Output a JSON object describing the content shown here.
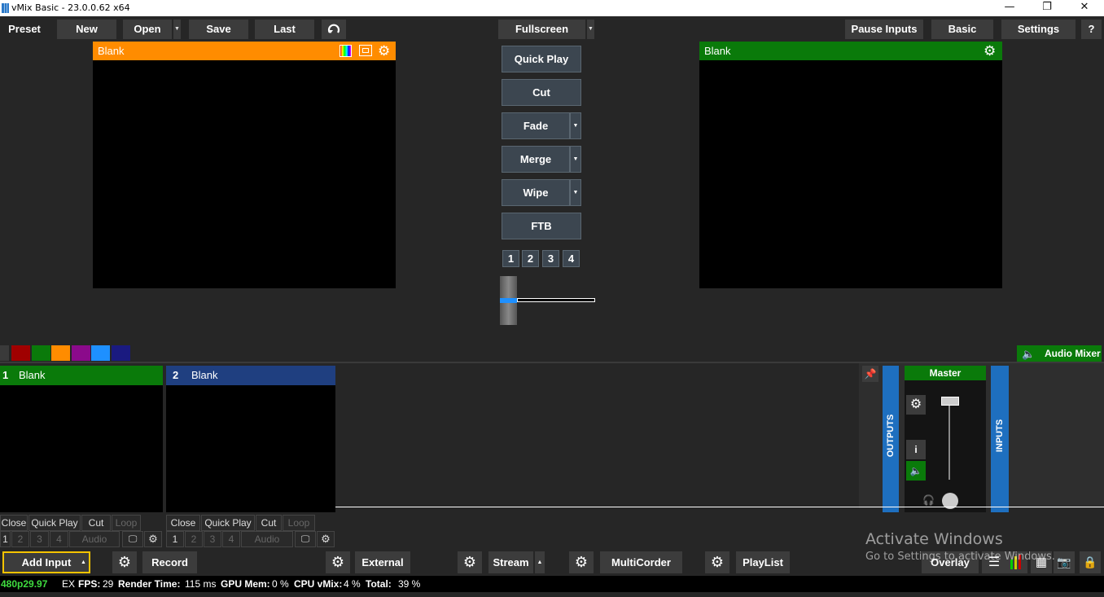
{
  "window": {
    "title": "vMix Basic - 23.0.0.62 x64",
    "minimize": "—",
    "restore": "❐",
    "close": "✕"
  },
  "toolbar": {
    "preset": "Preset",
    "new": "New",
    "open": "Open",
    "save": "Save",
    "last": "Last",
    "fullscreen": "Fullscreen",
    "pause_inputs": "Pause Inputs",
    "basic": "Basic",
    "settings": "Settings",
    "help": "?"
  },
  "preview": {
    "title": "Blank",
    "header_color": "#ff8c00"
  },
  "output": {
    "title": "Blank",
    "header_color": "#0a7a0a"
  },
  "transitions": {
    "quick_play": "Quick Play",
    "cut": "Cut",
    "fade": "Fade",
    "merge": "Merge",
    "wipe": "Wipe",
    "ftb": "FTB",
    "numbers": [
      "1",
      "2",
      "3",
      "4"
    ]
  },
  "colors": {
    "swatches": [
      "#3a3a3a",
      "#a00000",
      "#0a7a0a",
      "#ff8c00",
      "#8b0a8b",
      "#1e90ff",
      "#1a1a80"
    ],
    "accent": "#1e90ff"
  },
  "audio_mixer": {
    "label": "Audio Mixer",
    "master": "Master",
    "outputs": "OUTPUTS",
    "inputs": "INPUTS",
    "info": "i"
  },
  "inputs": [
    {
      "number": "1",
      "title": "Blank",
      "header_color": "#0a7a0a",
      "controls": [
        "Close",
        "Quick Play",
        "Cut",
        "Loop"
      ],
      "overlays": [
        "1",
        "2",
        "3",
        "4"
      ],
      "audio": "Audio"
    },
    {
      "number": "2",
      "title": "Blank",
      "header_color": "#1f3f80",
      "controls": [
        "Close",
        "Quick Play",
        "Cut",
        "Loop"
      ],
      "overlays": [
        "1",
        "2",
        "3",
        "4"
      ],
      "audio": "Audio"
    }
  ],
  "bottombar": {
    "add_input": "Add Input",
    "record": "Record",
    "external": "External",
    "stream": "Stream",
    "multicorder": "MultiCorder",
    "playlist": "PlayList",
    "overlay": "Overlay"
  },
  "watermark": {
    "line1": "Activate Windows",
    "line2": "Go to Settings to activate Windows."
  },
  "status": {
    "format": "480p29.97",
    "ex": "EX",
    "fps_label": "FPS:",
    "fps": "29",
    "render_label": "Render Time:",
    "render": "115 ms",
    "gpu_label": "GPU Mem:",
    "gpu": "0 %",
    "cpu_label": "CPU vMix:",
    "cpu": "4 %",
    "total_label": "Total:",
    "total": "39 %"
  }
}
